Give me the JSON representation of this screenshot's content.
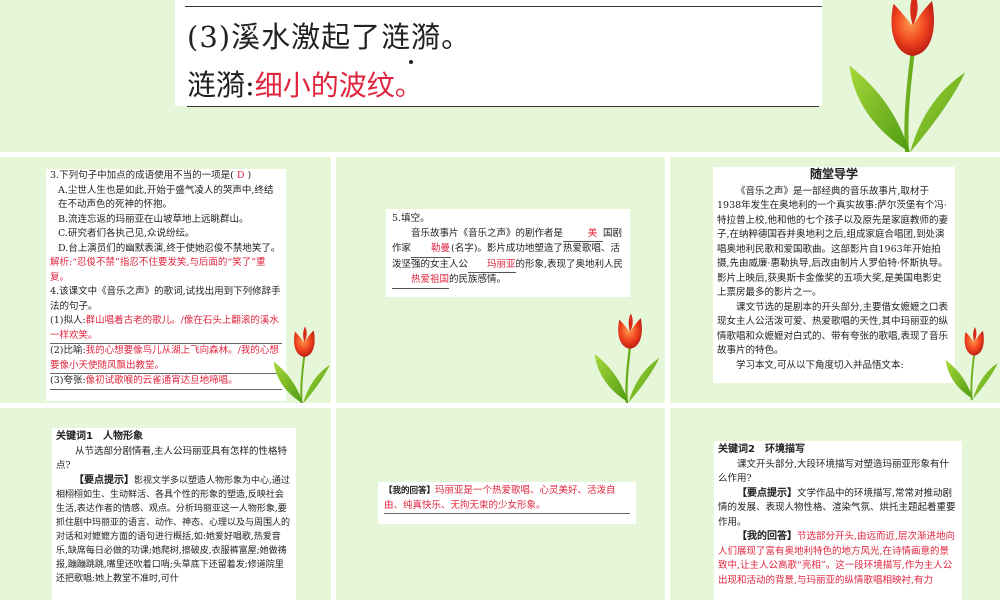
{
  "top": {
    "question_prefix": "(3)溪水激起了",
    "question_word": "涟漪",
    "question_suffix": "。",
    "answer_label": "涟漪:",
    "answer_text": "细小的波纹。"
  },
  "p1": {
    "q3_stem": "3.下列句子中加点的成语使用不当的一项是(",
    "q3_answer": "D",
    "q3_close": ")",
    "q3_a": "A.尘世人生也是如此,开始于盛气凌人的哭声中,终结在不动声色的死神的怀抱。",
    "q3_b": "B.流连忘返的玛丽亚在山坡草地上远眺群山。",
    "q3_c": "C.研究者们各执己见,众说纷纭。",
    "q3_d": "D.台上演员们的幽默表演,终于使她忍俊不禁地笑了。",
    "q3_analysis": "解析:“忍俊不禁”指忍不住要发笑,与后面的“笑了”重复。",
    "q4_stem": "4.该课文中《音乐之声》的歌词,试找出用到下列修辞手法的句子。",
    "q4_1_label": "(1)拟人:",
    "q4_1_answer": "群山唱着古老的歌儿。/像在石头上翻滚的溪水一样欢笑。",
    "q4_2_label": "(2)比喻:",
    "q4_2_answer": "我的心想要像鸟儿从湖上飞向森林。/我的心想要像小天使随风飘出教堂。",
    "q4_3_label": "(3)夸张:",
    "q4_3_answer": "像初试歌喉的云雀通宵达旦地啼唱。"
  },
  "p2": {
    "q5_stem": "5.填空。",
    "q5_t1": "音乐故事片《音乐之声》的剧作者是",
    "q5_f1": "美",
    "q5_t2": "国剧作家",
    "q5_f2": "勒曼",
    "q5_t3": "(名字)。影片成功地塑造了热爱歌唱、活泼坚强的女主人公",
    "q5_f3": "玛丽亚",
    "q5_t4": "的形象,表现了奥地利人民",
    "q5_f4": "热爱祖国",
    "q5_t5": "的民族感情。"
  },
  "p3": {
    "title": "随堂导学",
    "para1": "《音乐之声》是一部经典的音乐故事片,取材于1938年发生在奥地利的一个真实故事:萨尔茨堡有个冯·特拉普上校,他和他的七个孩子以及原先是家庭教师的妻子,在纳粹德国吞并奥地利之后,组成家庭合唱团,到处演唱奥地利民歌和爱国歌曲。这部影片自1963年开始拍摄,先由威廉·惠勒执导,后改由制片人罗伯特·怀斯执导。影片上映后,获奥斯卡金像奖的五项大奖,是美国电影史上票房最多的影片之一。",
    "para2": "课文节选的是剧本的开头部分,主要借女嬷嬷之口表现女主人公活泼可爱、热爱歌唱的天性,其中玛丽亚的纵情歌唱和众嬷嬷对白式的、带有夸张的歌唱,表现了音乐故事片的特色。",
    "para3": "学习本文,可从以下角度切入并品悟文本:"
  },
  "p4": {
    "heading": "关键词1　人物形象",
    "question": "从节选部分剧情看,主人公玛丽亚具有怎样的性格特点?",
    "tip_label": "【要点提示】",
    "tip_text": "影视文学多以塑造人物形象为中心,通过相栩栩如生、生动鲜活、各具个性的形象的塑造,反映社会生活,表达作者的情感、观点。分析玛丽亚这一人物形象,要抓住剧中玛丽亚的语言、动作、神态、心理以及与周围人的对话和对嬷嬷方面的语句进行概括,如:她爱好唱歌,热爱音乐,缺席每日必做的功课;她爬树,擦破皮,衣服裤富屋;她做祷报,蹦蹦跳跳,嘴里还吹着口哨;头草底下还留着发;修道院里还把歌唱;她上教堂不准时,可什"
  },
  "p5": {
    "answer_label": "【我的回答】",
    "answer_text": "玛丽亚是一个热爱歌唱、心灵美好、活泼自由、纯真快乐、无拘无束的少女形象。"
  },
  "p6": {
    "heading": "关键词2　环境描写",
    "question": "课文开头部分,大段环境描写对塑造玛丽亚形象有什么作用?",
    "tip_label": "【要点提示】",
    "tip_text": "文学作品中的环境描写,常常对推动剧情的发展、表现人物性格、渲染气氛、烘托主题起着重要作用。",
    "answer_label": "【我的回答】",
    "answer_text": "节选部分开头,由远而近,层次渐进地向人们展现了富有奥地利特色的地方风光,在诗情画意的景致中,让主人公高歌“亮相”。这一段环境描写,作为主人公出现和活动的背景,与玛丽亚的纵情歌唱相映衬,有力"
  },
  "colors": {
    "panel_bg": "#e6f6d8",
    "answer_red": "#e0263e"
  }
}
